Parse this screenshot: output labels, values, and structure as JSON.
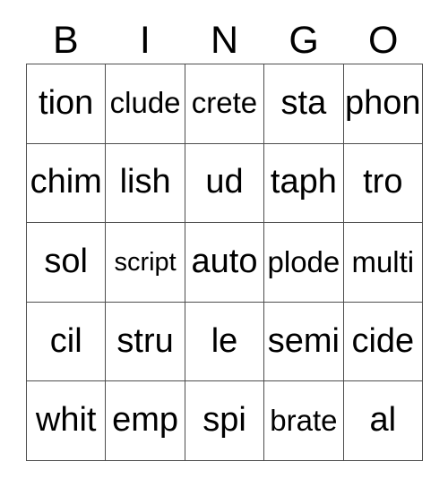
{
  "card": {
    "title": "BINGO",
    "columns": [
      "B",
      "I",
      "N",
      "G",
      "O"
    ],
    "rows": [
      {
        "cells": [
          "tion",
          "clude",
          "crete",
          "sta",
          "phon"
        ]
      },
      {
        "cells": [
          "chim",
          "lish",
          "ud",
          "taph",
          "tro"
        ]
      },
      {
        "cells": [
          "sol",
          "script",
          "auto",
          "plode",
          "multi"
        ]
      },
      {
        "cells": [
          "cil",
          "stru",
          "le",
          "semi",
          "cide"
        ]
      },
      {
        "cells": [
          "whit",
          "emp",
          "spi",
          "brate",
          "al"
        ]
      }
    ],
    "colors": {
      "background": "#ffffff",
      "border": "#4d4d4d",
      "text": "#000000"
    }
  }
}
